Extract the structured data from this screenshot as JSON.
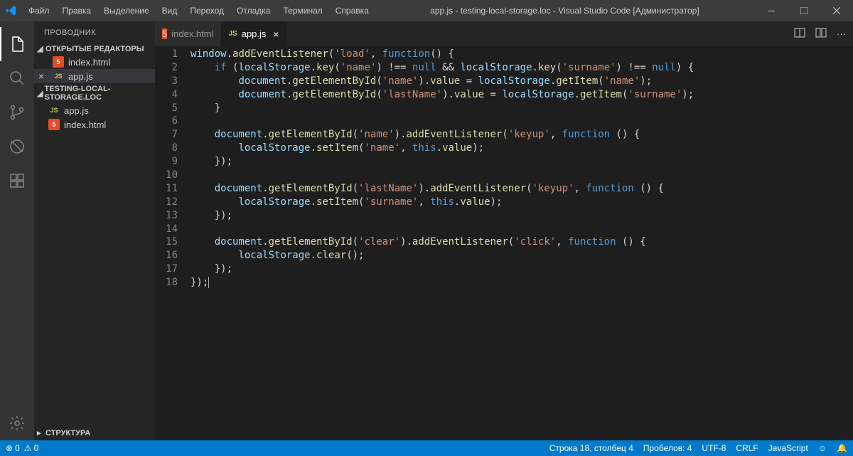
{
  "titlebar": {
    "menu": [
      "Файл",
      "Правка",
      "Выделение",
      "Вид",
      "Переход",
      "Отладка",
      "Терминал",
      "Справка"
    ],
    "title": "app.js - testing-local-storage.loc - Visual Studio Code [Администратор]"
  },
  "sidebar": {
    "title": "ПРОВОДНИК",
    "open_editors": "ОТКРЫТЫЕ РЕДАКТОРЫ",
    "workspace": "TESTING-LOCAL-STORAGE.LOC",
    "outline": "СТРУКТУРА",
    "files": {
      "index_html": "index.html",
      "app_js": "app.js"
    }
  },
  "tabs": [
    {
      "icon": "html",
      "label": "index.html",
      "active": false
    },
    {
      "icon": "js",
      "label": "app.js",
      "active": true
    }
  ],
  "code_lines": [
    "window.addEventListener('load', function() {",
    "    if (localStorage.key('name') !== null && localStorage.key('surname') !== null) {",
    "        document.getElementById('name').value = localStorage.getItem('name');",
    "        document.getElementById('lastName').value = localStorage.getItem('surname');",
    "    }",
    "",
    "    document.getElementById('name').addEventListener('keyup', function () {",
    "        localStorage.setItem('name', this.value);",
    "    });",
    "",
    "    document.getElementById('lastName').addEventListener('keyup', function () {",
    "        localStorage.setItem('surname', this.value);",
    "    });",
    "",
    "    document.getElementById('clear').addEventListener('click', function () {",
    "        localStorage.clear();",
    "    });",
    "});"
  ],
  "statusbar": {
    "errors": "0",
    "warnings": "0",
    "line_col": "Строка 18, столбец 4",
    "spaces": "Пробелов: 4",
    "encoding": "UTF-8",
    "eol": "CRLF",
    "language": "JavaScript"
  }
}
